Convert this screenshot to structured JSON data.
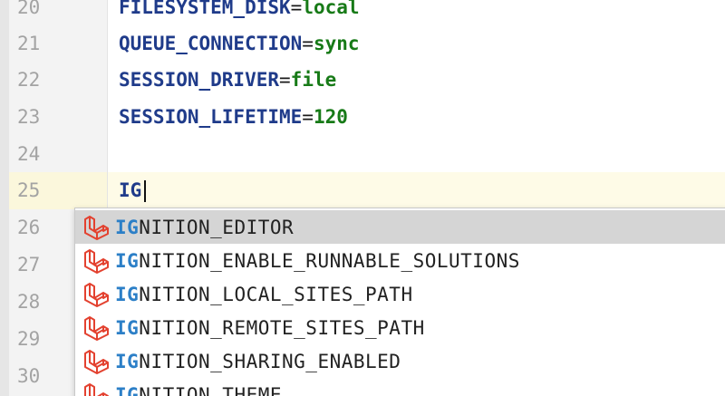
{
  "gutter": {
    "line_numbers": [
      "20",
      "21",
      "22",
      "23",
      "24",
      "25",
      "26",
      "27",
      "28",
      "29",
      "30"
    ]
  },
  "editor": {
    "lines": [
      {
        "key": "FILESYSTEM_DISK",
        "eq": "=",
        "value": "local"
      },
      {
        "key": "QUEUE_CONNECTION",
        "eq": "=",
        "value": "sync"
      },
      {
        "key": "SESSION_DRIVER",
        "eq": "=",
        "value": "file"
      },
      {
        "key": "SESSION_LIFETIME",
        "eq": "=",
        "value": "120"
      },
      {
        "key": "",
        "eq": "",
        "value": ""
      },
      {
        "key": "IG",
        "eq": "",
        "value": ""
      }
    ]
  },
  "completion": {
    "typed_prefix": "IG",
    "items": [
      {
        "match": "IG",
        "rest": "NITION_EDITOR",
        "selected": true
      },
      {
        "match": "IG",
        "rest": "NITION_ENABLE_RUNNABLE_SOLUTIONS",
        "selected": false
      },
      {
        "match": "IG",
        "rest": "NITION_LOCAL_SITES_PATH",
        "selected": false
      },
      {
        "match": "IG",
        "rest": "NITION_REMOTE_SITES_PATH",
        "selected": false
      },
      {
        "match": "IG",
        "rest": "NITION_SHARING_ENABLED",
        "selected": false
      },
      {
        "match": "IG",
        "rest": "NITION_THEME",
        "selected": false
      }
    ],
    "item_icon": "laravel-icon"
  },
  "colors": {
    "key": "#1f3b8a",
    "value": "#177a17",
    "match": "#2c7fc7",
    "icon": "#e3412f",
    "selected_bg": "#d5d5d5",
    "current_line_bg": "#fefbe7"
  }
}
